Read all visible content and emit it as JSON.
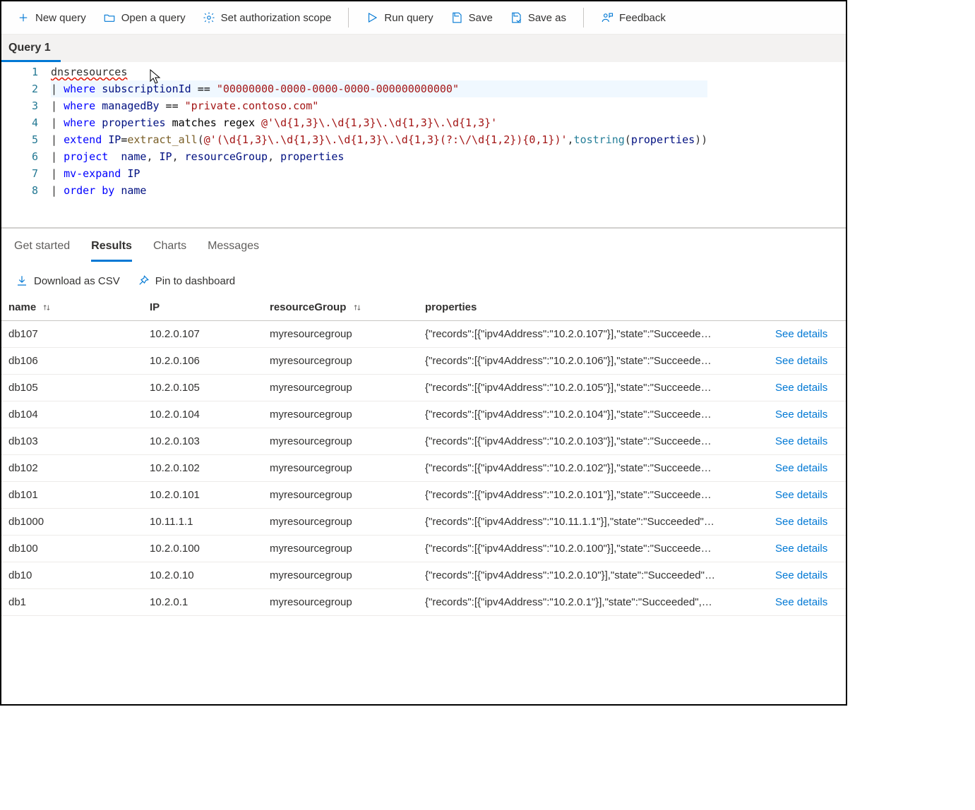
{
  "toolbar": {
    "new_query": "New query",
    "open_query": "Open a query",
    "auth_scope": "Set authorization scope",
    "run_query": "Run query",
    "save": "Save",
    "save_as": "Save as",
    "feedback": "Feedback"
  },
  "tabs": {
    "active": "Query 1"
  },
  "editor": {
    "lines": [
      {
        "n": "1",
        "segs": [
          {
            "t": "dnsresources",
            "c": "ident"
          }
        ]
      },
      {
        "n": "2",
        "hl": true,
        "segs": [
          {
            "t": "| ",
            "c": "punc"
          },
          {
            "t": "where",
            "c": "kw"
          },
          {
            "t": " ",
            "c": ""
          },
          {
            "t": "subscriptionId",
            "c": "field"
          },
          {
            "t": " == ",
            "c": "op"
          },
          {
            "t": "\"00000000-0000-0000-0000-000000000000\"",
            "c": "str"
          }
        ]
      },
      {
        "n": "3",
        "segs": [
          {
            "t": "| ",
            "c": "punc"
          },
          {
            "t": "where",
            "c": "kw"
          },
          {
            "t": " ",
            "c": ""
          },
          {
            "t": "managedBy",
            "c": "field"
          },
          {
            "t": " == ",
            "c": "op"
          },
          {
            "t": "\"private.contoso.com\"",
            "c": "str"
          }
        ]
      },
      {
        "n": "4",
        "segs": [
          {
            "t": "| ",
            "c": "punc"
          },
          {
            "t": "where",
            "c": "kw"
          },
          {
            "t": " ",
            "c": ""
          },
          {
            "t": "properties",
            "c": "field"
          },
          {
            "t": " ",
            "c": ""
          },
          {
            "t": "matches regex",
            "c": "op"
          },
          {
            "t": " ",
            "c": ""
          },
          {
            "t": "@'\\d{1,3}\\.\\d{1,3}\\.\\d{1,3}\\.\\d{1,3}'",
            "c": "str"
          }
        ]
      },
      {
        "n": "5",
        "segs": [
          {
            "t": "| ",
            "c": "punc"
          },
          {
            "t": "extend",
            "c": "kw"
          },
          {
            "t": " ",
            "c": ""
          },
          {
            "t": "IP",
            "c": "field"
          },
          {
            "t": "=",
            "c": "op"
          },
          {
            "t": "extract_all",
            "c": "fn"
          },
          {
            "t": "(",
            "c": "punc"
          },
          {
            "t": "@'(\\d{1,3}\\.\\d{1,3}\\.\\d{1,3}\\.\\d{1,3}(?:\\/\\d{1,2}){0,1})'",
            "c": "str"
          },
          {
            "t": ",",
            "c": "punc"
          },
          {
            "t": "tostring",
            "c": "tsfn"
          },
          {
            "t": "(",
            "c": "punc"
          },
          {
            "t": "properties",
            "c": "field"
          },
          {
            "t": "))",
            "c": "punc"
          }
        ]
      },
      {
        "n": "6",
        "segs": [
          {
            "t": "| ",
            "c": "punc"
          },
          {
            "t": "project",
            "c": "kw"
          },
          {
            "t": "  ",
            "c": ""
          },
          {
            "t": "name",
            "c": "field"
          },
          {
            "t": ", ",
            "c": "punc"
          },
          {
            "t": "IP",
            "c": "field"
          },
          {
            "t": ", ",
            "c": "punc"
          },
          {
            "t": "resourceGroup",
            "c": "field"
          },
          {
            "t": ", ",
            "c": "punc"
          },
          {
            "t": "properties",
            "c": "field"
          }
        ]
      },
      {
        "n": "7",
        "segs": [
          {
            "t": "| ",
            "c": "punc"
          },
          {
            "t": "mv-expand",
            "c": "kw"
          },
          {
            "t": " ",
            "c": ""
          },
          {
            "t": "IP",
            "c": "field"
          }
        ]
      },
      {
        "n": "8",
        "segs": [
          {
            "t": "| ",
            "c": "punc"
          },
          {
            "t": "order",
            "c": "kw"
          },
          {
            "t": " ",
            "c": ""
          },
          {
            "t": "by",
            "c": "kw"
          },
          {
            "t": " ",
            "c": ""
          },
          {
            "t": "name",
            "c": "field"
          }
        ]
      }
    ]
  },
  "result_tabs": {
    "get_started": "Get started",
    "results": "Results",
    "charts": "Charts",
    "messages": "Messages"
  },
  "result_actions": {
    "download_csv": "Download as CSV",
    "pin_dashboard": "Pin to dashboard"
  },
  "table": {
    "headers": {
      "name": "name",
      "ip": "IP",
      "rg": "resourceGroup",
      "prop": "properties"
    },
    "see_details": "See details",
    "rows": [
      {
        "name": "db107",
        "ip": "10.2.0.107",
        "rg": "myresourcegroup",
        "prop": "{\"records\":[{\"ipv4Address\":\"10.2.0.107\"}],\"state\":\"Succeede…"
      },
      {
        "name": "db106",
        "ip": "10.2.0.106",
        "rg": "myresourcegroup",
        "prop": "{\"records\":[{\"ipv4Address\":\"10.2.0.106\"}],\"state\":\"Succeede…"
      },
      {
        "name": "db105",
        "ip": "10.2.0.105",
        "rg": "myresourcegroup",
        "prop": "{\"records\":[{\"ipv4Address\":\"10.2.0.105\"}],\"state\":\"Succeede…"
      },
      {
        "name": "db104",
        "ip": "10.2.0.104",
        "rg": "myresourcegroup",
        "prop": "{\"records\":[{\"ipv4Address\":\"10.2.0.104\"}],\"state\":\"Succeede…"
      },
      {
        "name": "db103",
        "ip": "10.2.0.103",
        "rg": "myresourcegroup",
        "prop": "{\"records\":[{\"ipv4Address\":\"10.2.0.103\"}],\"state\":\"Succeede…"
      },
      {
        "name": "db102",
        "ip": "10.2.0.102",
        "rg": "myresourcegroup",
        "prop": "{\"records\":[{\"ipv4Address\":\"10.2.0.102\"}],\"state\":\"Succeede…"
      },
      {
        "name": "db101",
        "ip": "10.2.0.101",
        "rg": "myresourcegroup",
        "prop": "{\"records\":[{\"ipv4Address\":\"10.2.0.101\"}],\"state\":\"Succeede…"
      },
      {
        "name": "db1000",
        "ip": "10.11.1.1",
        "rg": "myresourcegroup",
        "prop": "{\"records\":[{\"ipv4Address\":\"10.11.1.1\"}],\"state\":\"Succeeded\"…"
      },
      {
        "name": "db100",
        "ip": "10.2.0.100",
        "rg": "myresourcegroup",
        "prop": "{\"records\":[{\"ipv4Address\":\"10.2.0.100\"}],\"state\":\"Succeede…"
      },
      {
        "name": "db10",
        "ip": "10.2.0.10",
        "rg": "myresourcegroup",
        "prop": "{\"records\":[{\"ipv4Address\":\"10.2.0.10\"}],\"state\":\"Succeeded\"…"
      },
      {
        "name": "db1",
        "ip": "10.2.0.1",
        "rg": "myresourcegroup",
        "prop": "{\"records\":[{\"ipv4Address\":\"10.2.0.1\"}],\"state\":\"Succeeded\",…"
      }
    ]
  }
}
